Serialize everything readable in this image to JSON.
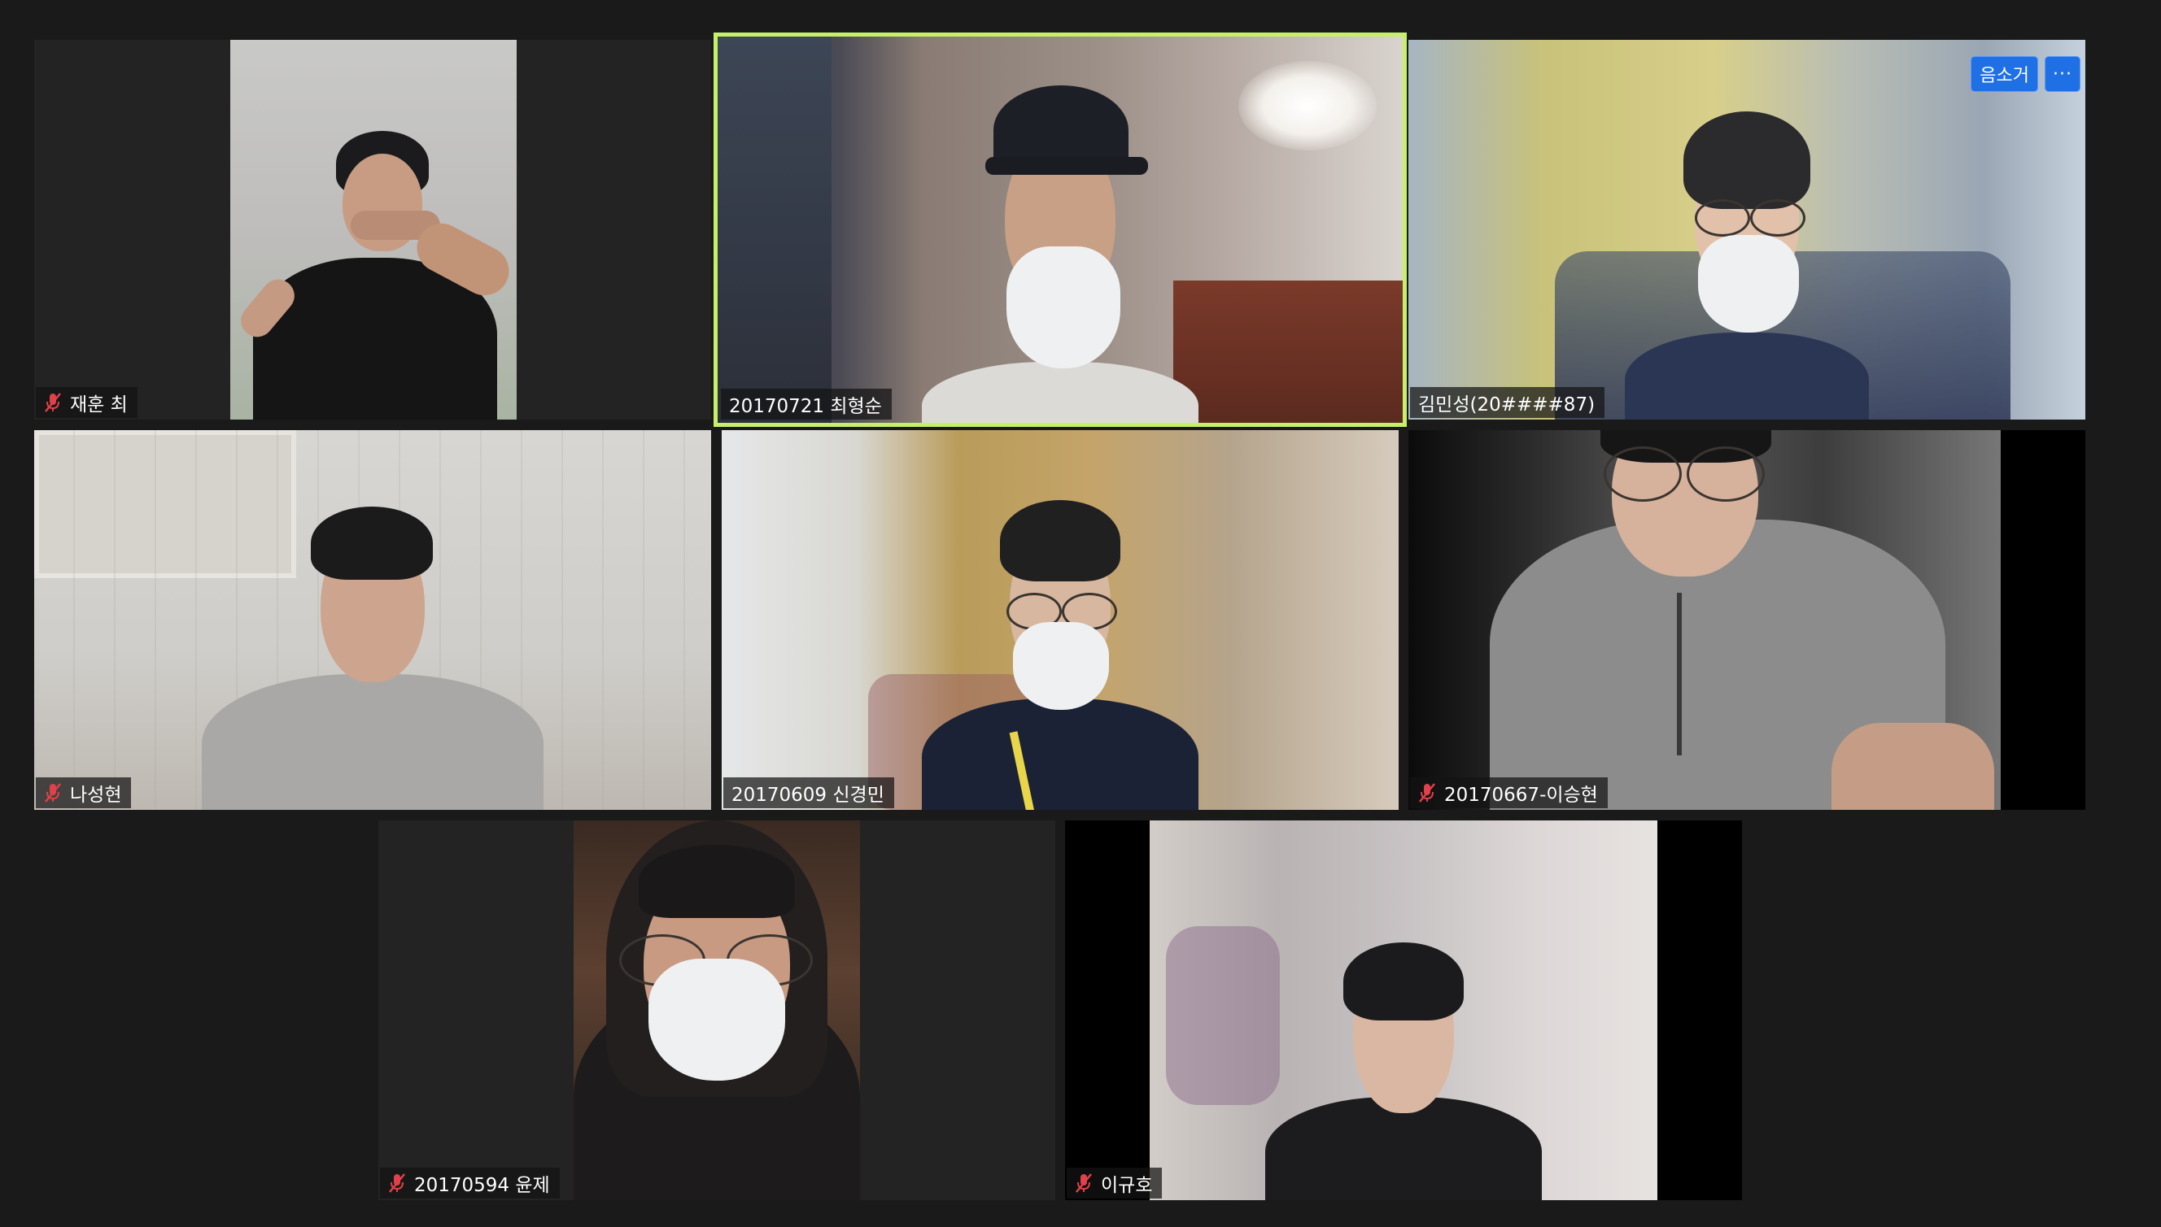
{
  "window": {
    "app": "Video conference gallery view"
  },
  "controls": {
    "remove_audio_label": "음소거",
    "more_label": "···"
  },
  "participants": [
    {
      "name": "재훈 최",
      "muted": true,
      "active_speaker": false
    },
    {
      "name": "20170721 최형순",
      "muted": false,
      "active_speaker": true
    },
    {
      "name": "김민성(20####87)",
      "muted": false,
      "active_speaker": false
    },
    {
      "name": "나성현",
      "muted": true,
      "active_speaker": false
    },
    {
      "name": "20170609 신경민",
      "muted": false,
      "active_speaker": false
    },
    {
      "name": "20170667-이승현",
      "muted": true,
      "active_speaker": false
    },
    {
      "name": "20170594 윤제",
      "muted": true,
      "active_speaker": false
    },
    {
      "name": "이규호",
      "muted": true,
      "active_speaker": false
    }
  ],
  "colors": {
    "background": "#1a1a1a",
    "tile_background": "#232323",
    "active_speaker_border": "#c7f06a",
    "muted_icon": "#e0414a",
    "control_button": "#1f6fe5"
  },
  "icons": {
    "muted": "mic-muted-icon",
    "more": "more-icon"
  }
}
